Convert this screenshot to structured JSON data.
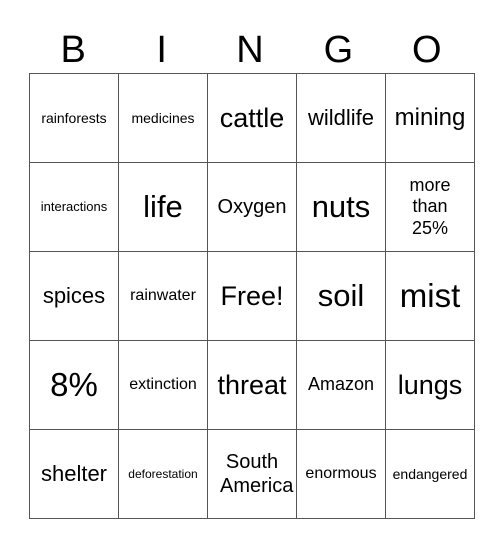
{
  "header": [
    "B",
    "I",
    "N",
    "G",
    "O"
  ],
  "rows": [
    [
      "rainforests",
      "medicines",
      "cattle",
      "wildlife",
      "mining"
    ],
    [
      "interactions",
      "life",
      "Oxygen",
      "nuts",
      "more than 25%"
    ],
    [
      "spices",
      "rainwater",
      "Free!",
      "soil",
      "mist"
    ],
    [
      "8%",
      "extinction",
      "threat",
      "Amazon",
      "lungs"
    ],
    [
      "shelter",
      "deforestation",
      "South America",
      "enormous",
      "endangered"
    ]
  ]
}
